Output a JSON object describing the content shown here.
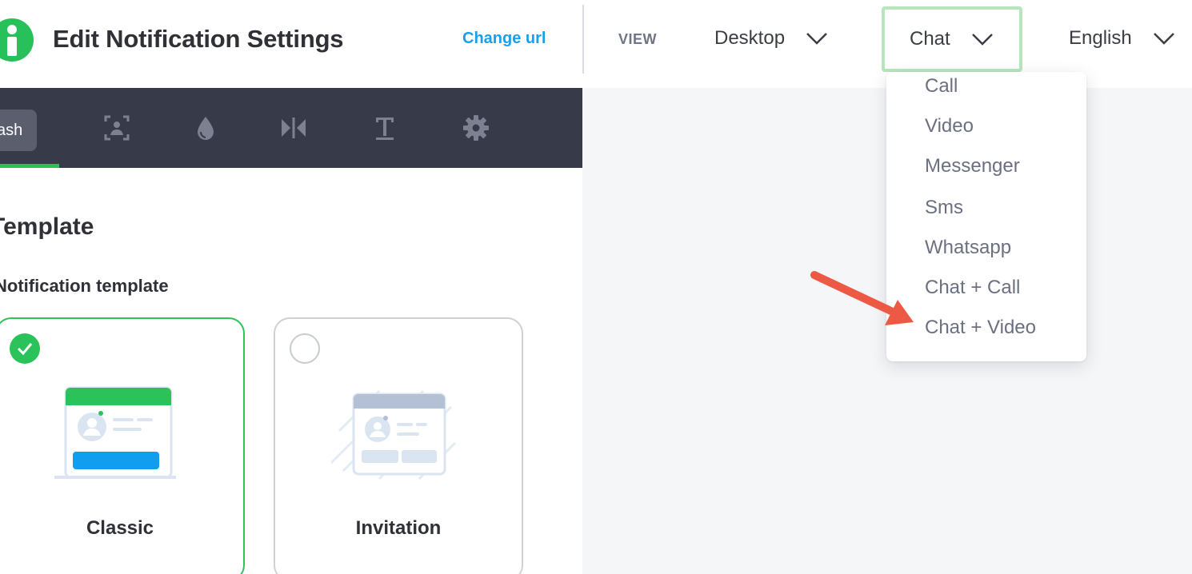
{
  "header": {
    "title": "Edit Notification Settings",
    "change_url": "Change url",
    "view_label": "VIEW",
    "device_dropdown": "Desktop",
    "channel_dropdown": "Chat",
    "language_dropdown": "English"
  },
  "toolbar": {
    "active_tab_label": "ash",
    "tabs": [
      "image-frame-icon",
      "droplet-icon",
      "flip-icon",
      "text-icon",
      "gear-icon"
    ]
  },
  "panel": {
    "section_title": "Template",
    "section_subtitle": "Notification template",
    "cards": [
      {
        "label": "Classic",
        "selected": true
      },
      {
        "label": "Invitation",
        "selected": false
      }
    ]
  },
  "channel_menu": {
    "items": [
      "Call",
      "Video",
      "Messenger",
      "Sms",
      "Whatsapp",
      "Chat + Call",
      "Chat + Video"
    ]
  },
  "colors": {
    "accent_green": "#27c05a",
    "link_blue": "#1a9fe8",
    "toolbar_bg": "#373b49",
    "annotation_arrow": "#ec5a46"
  }
}
